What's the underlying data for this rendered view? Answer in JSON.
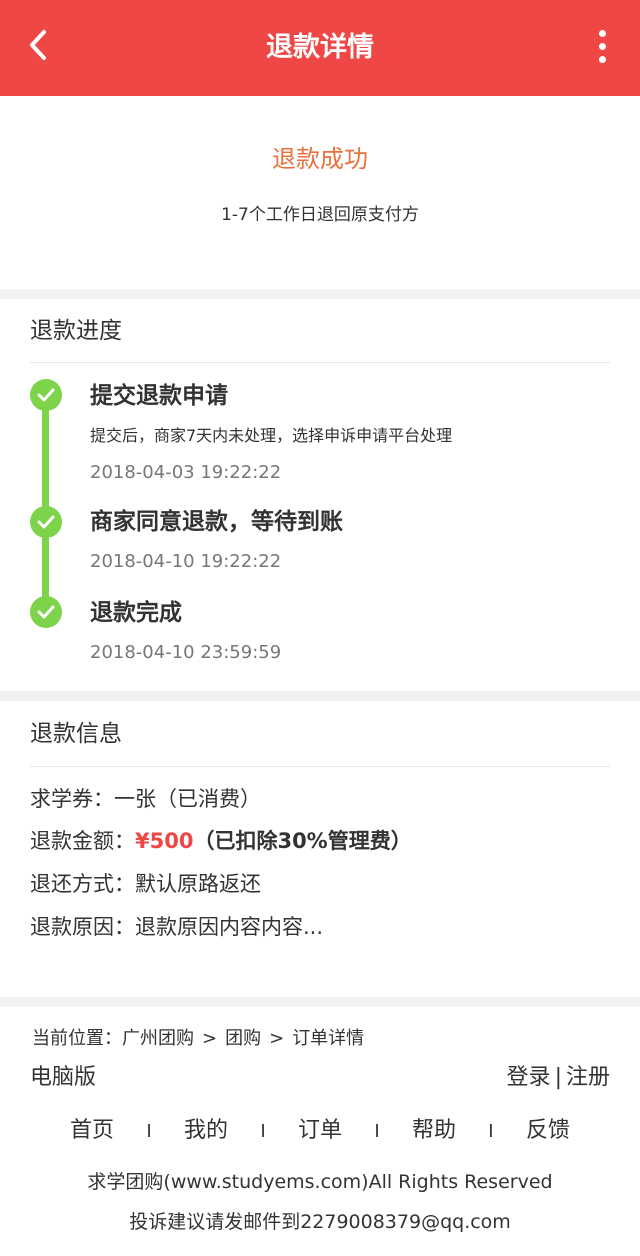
{
  "header": {
    "title": "退款详情"
  },
  "status": {
    "title": "退款成功",
    "subtitle": "1-7个工作日退回原支付方"
  },
  "progress": {
    "section_title": "退款进度",
    "steps": [
      {
        "title": "提交退款申请",
        "desc": "提交后，商家7天内未处理，选择申诉申请平台处理",
        "time": "2018-04-03 19:22:22"
      },
      {
        "title": "商家同意退款，等待到账",
        "time": "2018-04-10 19:22:22"
      },
      {
        "title": "退款完成",
        "time": "2018-04-10 23:59:59"
      }
    ]
  },
  "info": {
    "section_title": "退款信息",
    "voucher_label": "求学券：",
    "voucher_value": "一张（已消费）",
    "amount_label": "退款金额：",
    "amount_value": "¥500",
    "amount_note": "（已扣除30%管理费）",
    "method_label": "退还方式：",
    "method_value": "默认原路返还",
    "reason_label": "退款原因：",
    "reason_value": "退款原因内容内容..."
  },
  "footer": {
    "crumb_label": "当前位置：",
    "crumbs": [
      "广州团购",
      "团购",
      "订单详情"
    ],
    "crumb_sep": ">",
    "pc_version": "电脑版",
    "login": "登录",
    "auth_sep": "|",
    "register": "注册",
    "nav": [
      "首页",
      "我的",
      "订单",
      "帮助",
      "反馈"
    ],
    "nav_sep": "I",
    "copyright": "求学团购(www.studyems.com)All Rights Reserved",
    "contact": "投诉建议请发邮件到2279008379@qq.com"
  },
  "colors": {
    "header": "#ef4646",
    "success": "#e8713c",
    "check": "#7dd44a",
    "price": "#ef4646"
  },
  "icons": {
    "back": "chevron-left-icon",
    "more": "more-vertical-icon",
    "check": "check-icon"
  }
}
